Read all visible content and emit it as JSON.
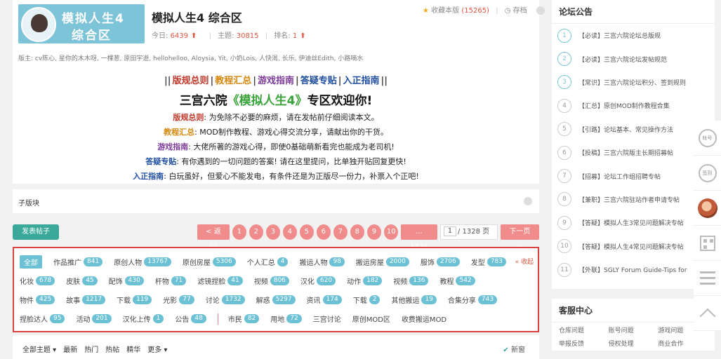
{
  "forum": {
    "logo_line1": "模拟人生4",
    "logo_line2": "综合区",
    "title": "模拟人生4 综合区",
    "today_label": "今日:",
    "today": "6439",
    "topics_label": "主题:",
    "topics": "30815",
    "rank_label": "排名:",
    "rank": "1",
    "fav_label": "收藏本版",
    "fav_count": "(15265)",
    "save_label": "存档",
    "moderators": "版主: cv陈心, 星你的木木呀, 一棵葱, 原田宇逝, hellohelloo, Aloysia, Yit, 小奶Lois, 人快渴, 长乐, 伊迪丝Edith, 小路嘀水"
  },
  "rules": {
    "links": [
      {
        "text": "||",
        "color": "#444"
      },
      {
        "text": "版规总则",
        "color": "#c0392b"
      },
      {
        "text": "|",
        "color": "#444"
      },
      {
        "text": "教程汇总",
        "color": "#d68910"
      },
      {
        "text": "|",
        "color": "#444"
      },
      {
        "text": "游戏指南",
        "color": "#7d3c98"
      },
      {
        "text": "|",
        "color": "#444"
      },
      {
        "text": "答疑专贴",
        "color": "#1f4e9e"
      },
      {
        "text": "|",
        "color": "#444"
      },
      {
        "text": "入正指南",
        "color": "#1f4e9e"
      },
      {
        "text": "||",
        "color": "#444"
      }
    ],
    "headline_pre": "三宫六院",
    "headline_hl": "《模拟人生4》",
    "headline_post": "专区欢迎你!",
    "lines": [
      {
        "label": "版规总则",
        "color": "#c0392b",
        "text": ": 为免除不必要的麻烦，请在发帖前仔细阅读本文。"
      },
      {
        "label": "教程汇总",
        "color": "#d68910",
        "text": ": MOD制作教程、游戏心得交流分享，请献出你的干货。"
      },
      {
        "label": "游戏指南",
        "color": "#7d3c98",
        "text": ": 大佬所著的游戏心得，即使0基础萌新看完也能成为老司机!"
      },
      {
        "label": "答疑专贴",
        "color": "#1f4e9e",
        "text": ": 有你遇到的一切问题的答案! 请在这里提问，比单独开贴回复更快!"
      },
      {
        "label": "入正指南",
        "color": "#1f4e9e",
        "text": ": 白玩虽好，但爱心不能发电，有条件还是为正版尽一份力，补票入个正吧!"
      }
    ]
  },
  "subboard": {
    "label": "子版块"
  },
  "toolbar": {
    "post_label": "发表帖子",
    "prev_label": "< 返回",
    "pages": [
      "1",
      "2",
      "3",
      "4",
      "5",
      "6",
      "7",
      "8",
      "9",
      "10"
    ],
    "last_page": "... 1328",
    "page_input": "1",
    "page_total": "/ 1328 页",
    "next_label": "下一页 >"
  },
  "categories": {
    "collapse_label": "« 收起",
    "rows": [
      [
        {
          "label": "全部",
          "selected": true
        },
        {
          "label": "作品推广",
          "count": "841"
        },
        {
          "label": "原创人物",
          "count": "13767"
        },
        {
          "label": "原创房屋",
          "count": "5306"
        },
        {
          "label": "个人汇总",
          "count": "4"
        },
        {
          "label": "搬运人物",
          "count": "98"
        },
        {
          "label": "搬运房屋",
          "count": "2000"
        },
        {
          "label": "服饰",
          "count": "2706"
        },
        {
          "label": "发型",
          "count": "783"
        }
      ],
      [
        {
          "label": "化妆",
          "count": "678"
        },
        {
          "label": "皮肤",
          "count": "45"
        },
        {
          "label": "配饰",
          "count": "430"
        },
        {
          "label": "杆物",
          "count": "71"
        },
        {
          "label": "滤镜捏脸",
          "count": "41"
        },
        {
          "label": "视频",
          "count": "806"
        },
        {
          "label": "汉化",
          "count": "620"
        },
        {
          "label": "动作",
          "count": "182"
        },
        {
          "label": "视频",
          "count": "136"
        },
        {
          "label": "教程",
          "count": "542"
        }
      ],
      [
        {
          "label": "物件",
          "count": "425"
        },
        {
          "label": "故事",
          "count": "1217"
        },
        {
          "label": "下载",
          "count": "119"
        },
        {
          "label": "光影",
          "count": "77"
        },
        {
          "label": "讨论",
          "count": "1732"
        },
        {
          "label": "解惑",
          "count": "5297"
        },
        {
          "label": "资讯",
          "count": "174"
        },
        {
          "label": "下载",
          "count": "2"
        },
        {
          "label": "其他搬运",
          "count": "19"
        },
        {
          "label": "合集分享",
          "count": "743"
        }
      ],
      [
        {
          "label": "捏脸达人",
          "count": "95"
        },
        {
          "label": "活动",
          "count": "201"
        },
        {
          "label": "汉化上传",
          "count": "1"
        },
        {
          "label": "公告",
          "count": "48"
        },
        {
          "divider": true
        },
        {
          "label": "市民",
          "count": "82"
        },
        {
          "label": "用地",
          "count": "72"
        },
        {
          "label": "三宫讨论"
        },
        {
          "label": "原创MOD区"
        },
        {
          "label": "收费搬运MOD"
        }
      ]
    ]
  },
  "filter": {
    "items": [
      "全部主题 ▾",
      "最新",
      "热门",
      "热帖",
      "精华",
      "更多 ▾"
    ],
    "new_label": "新窗"
  },
  "notice": {
    "title": "论坛公告",
    "items": [
      {
        "n": "1",
        "text": "【必读】三宫六院论坛总版规"
      },
      {
        "n": "2",
        "text": "【必读】三宫六院论坛发帖规范"
      },
      {
        "n": "3",
        "text": "【常识】三宫六院论坛积分、签到规则"
      },
      {
        "n": "4",
        "text": "【汇总】原创MOD制作教程合集"
      },
      {
        "n": "5",
        "text": "【引路】论坛基本、常见操作方法"
      },
      {
        "n": "6",
        "text": "【投稿】三宫六院版主长期招募帖"
      },
      {
        "n": "7",
        "text": "【招募】论坛工作组招聘专帖"
      },
      {
        "n": "8",
        "text": "【兼职】三宫六院驻站作者申请专帖"
      },
      {
        "n": "9",
        "text": "【答疑】模拟人生3常见问题解决专帖"
      },
      {
        "n": "10",
        "text": "【答疑】模拟人生4常见问题解决专帖"
      },
      {
        "n": "11",
        "text": "【外联】SGLY Forum Guide-Tips for"
      }
    ]
  },
  "service": {
    "title": "客服中心",
    "items": [
      "仓库问题",
      "账号问题",
      "游戏问题",
      "举报反馈",
      "侵权处理",
      "商业合作"
    ]
  },
  "rail": {
    "btn1": "帐号",
    "btn2": "签到"
  }
}
